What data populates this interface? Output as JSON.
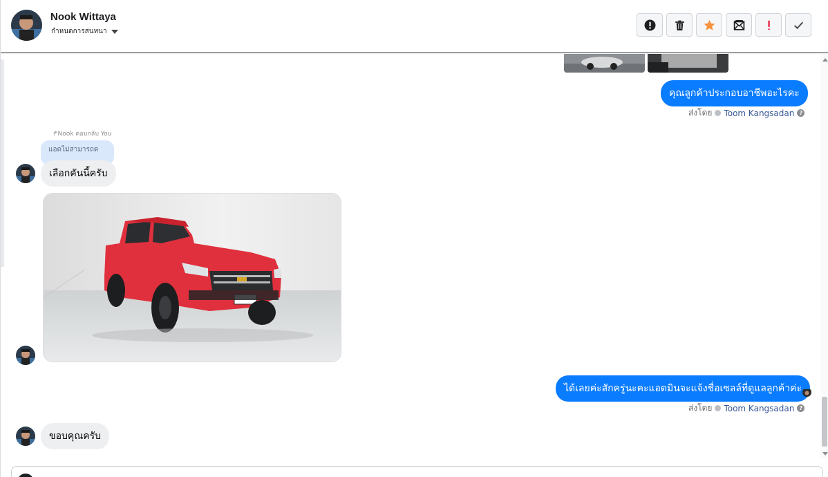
{
  "header": {
    "contact_name": "Nook Wittaya",
    "subtitle": "กำหนดการสนทนา",
    "toolbar": [
      {
        "name": "mark-spam-button",
        "icon": "alert-circle-icon"
      },
      {
        "name": "delete-button",
        "icon": "trash-icon"
      },
      {
        "name": "star-button",
        "icon": "star-icon"
      },
      {
        "name": "mark-unread-button",
        "icon": "envelope-icon"
      },
      {
        "name": "important-button",
        "icon": "exclamation-icon"
      },
      {
        "name": "mark-done-button",
        "icon": "check-icon"
      }
    ]
  },
  "messages": {
    "out_1": {
      "text": "คุณลูกค้าประกอบอาชีพอะไรคะ",
      "sent_by_label": "ส่งโดย",
      "sender": "Toom Kangsadan"
    },
    "reply_note": "Nook ตอบกลับ You",
    "quoted_text": "แอดไม่สามารถด",
    "in_1": {
      "text": "เลือกคันนี้ครับ"
    },
    "out_2": {
      "text": "ได้เลยค่ะสักครู่นะคะแอดมินจะแจ้งชื่อเซลล์ที่ดูแลลูกค้าค่ะ",
      "sent_by_label": "ส่งโดย",
      "sender": "Toom Kangsadan"
    },
    "in_2": {
      "text": "ขอบคุณครับ"
    }
  },
  "colors": {
    "outgoing_bubble": "#0a7cff",
    "incoming_bubble": "#eeeff1",
    "star": "#f7923a",
    "important": "#e41e3f"
  }
}
